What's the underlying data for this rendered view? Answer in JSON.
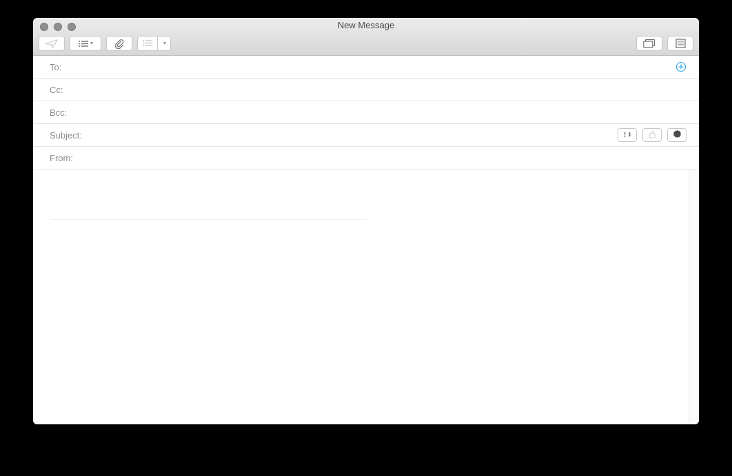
{
  "window": {
    "title": "New Message"
  },
  "toolbar": {
    "send_label": "Send",
    "headers_label": "Header Fields",
    "attach_label": "Attach",
    "format_label": "Format",
    "media_label": "Photo Browser",
    "stationery_label": "Show Stationery"
  },
  "fields": {
    "to": {
      "label": "To:",
      "value": ""
    },
    "cc": {
      "label": "Cc:",
      "value": ""
    },
    "bcc": {
      "label": "Bcc:",
      "value": ""
    },
    "subject": {
      "label": "Subject:",
      "value": ""
    },
    "from": {
      "label": "From:",
      "value": ""
    },
    "priority_marker": "!"
  },
  "icons": {
    "add_contact": "add-contact-icon",
    "lock": "lock-icon",
    "signed": "signed-icon"
  },
  "body": {
    "text": ""
  }
}
